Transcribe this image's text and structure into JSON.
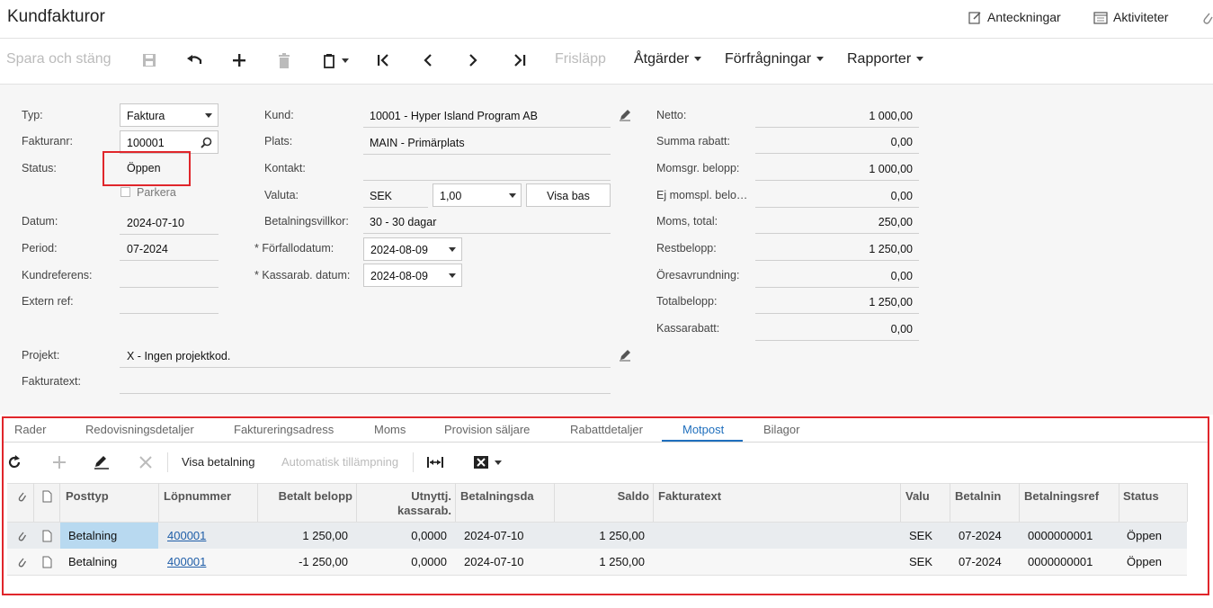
{
  "page": {
    "title": "Kundfakturor"
  },
  "header_links": {
    "notes": "Anteckningar",
    "activities": "Aktiviteter"
  },
  "toolbar": {
    "save_close": "Spara och stäng",
    "release": "Frisläpp",
    "actions": "Åtgärder",
    "inquiries": "Förfrågningar",
    "reports": "Rapporter"
  },
  "form": {
    "type_label": "Typ:",
    "type_value": "Faktura",
    "invoice_no_label": "Fakturanr:",
    "invoice_no_value": "100001",
    "status_label": "Status:",
    "status_value": "Öppen",
    "hold_label": "Parkera",
    "date_label": "Datum:",
    "date_value": "2024-07-10",
    "period_label": "Period:",
    "period_value": "07-2024",
    "cust_ref_label": "Kundreferens:",
    "cust_ref_value": "",
    "ext_ref_label": "Extern ref:",
    "ext_ref_value": "",
    "customer_label": "Kund:",
    "customer_value": "10001 - Hyper Island Program AB",
    "location_label": "Plats:",
    "location_value": "MAIN - Primärplats",
    "contact_label": "Kontakt:",
    "contact_value": "",
    "currency_label": "Valuta:",
    "currency_value": "SEK",
    "rate_value": "1,00",
    "view_base": "Visa bas",
    "terms_label": "Betalningsvillkor:",
    "terms_value": "30 - 30 dagar",
    "due_date_label": "Förfallodatum:",
    "due_date_value": "2024-08-09",
    "cash_disc_date_label": "Kassarab. datum:",
    "cash_disc_date_value": "2024-08-09",
    "project_label": "Projekt:",
    "project_value": "X - Ingen projektkod.",
    "invoice_text_label": "Fakturatext:",
    "invoice_text_value": "",
    "required_mark": "*"
  },
  "totals": [
    {
      "label": "Netto:",
      "value": "1 000,00"
    },
    {
      "label": "Summa rabatt:",
      "value": "0,00"
    },
    {
      "label": "Momsgr. belopp:",
      "value": "1 000,00"
    },
    {
      "label": "Ej momspl. belo…",
      "value": "0,00"
    },
    {
      "label": "Moms, total:",
      "value": "250,00"
    },
    {
      "label": "Restbelopp:",
      "value": "1 250,00"
    },
    {
      "label": "Öresavrundning:",
      "value": "0,00"
    },
    {
      "label": "Totalbelopp:",
      "value": "1 250,00"
    },
    {
      "label": "Kassarabatt:",
      "value": "0,00"
    }
  ],
  "tabs": [
    "Rader",
    "Redovisningsdetaljer",
    "Faktureringsadress",
    "Moms",
    "Provision säljare",
    "Rabattdetaljer",
    "Motpost",
    "Bilagor"
  ],
  "active_tab": "Motpost",
  "grid_toolbar": {
    "view_payment": "Visa betalning",
    "auto_apply": "Automatisk tillämpning"
  },
  "grid": {
    "columns": [
      "Posttyp",
      "Löpnummer",
      "Betalt belopp",
      "Utnyttj.",
      "kassarab.",
      "Betalningsda",
      "Saldo",
      "Fakturatext",
      "Valu",
      "Betalnin",
      "Betalningsref",
      "Status"
    ],
    "rows": [
      [
        "Betalning",
        "400001",
        "1 250,00",
        "0,0000",
        "2024-07-10",
        "1 250,00",
        "",
        "SEK",
        "07-2024",
        "0000000001",
        "Öppen"
      ],
      [
        "Betalning",
        "400001",
        "-1 250,00",
        "0,0000",
        "2024-07-10",
        "1 250,00",
        "",
        "SEK",
        "07-2024",
        "0000000001",
        "Öppen"
      ]
    ]
  },
  "colors": {
    "accent": "#1f6fbd",
    "highlight": "#e0262b",
    "selected_cell": "#b8d9f0"
  }
}
